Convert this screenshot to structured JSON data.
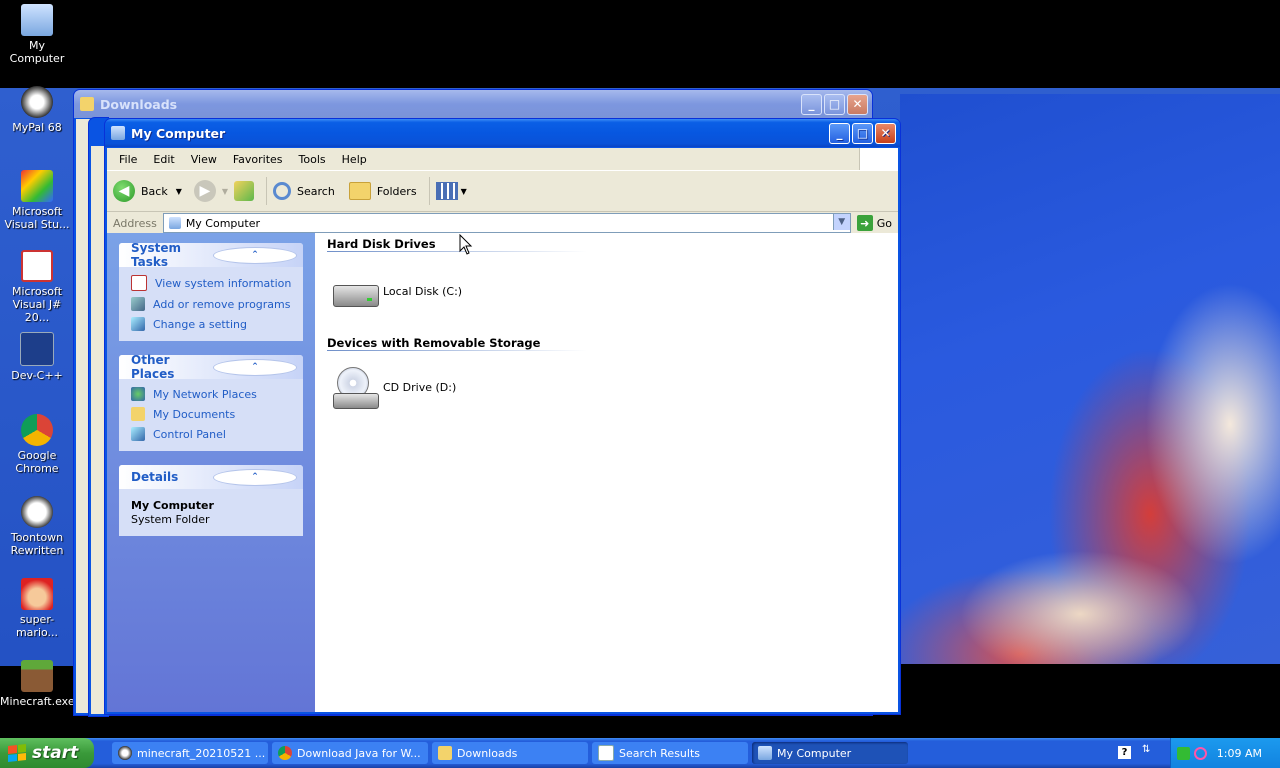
{
  "desktop": {
    "icons": [
      {
        "label": "My Computer"
      },
      {
        "label": "MyPal 68"
      },
      {
        "label": "Microsoft Visual Stu..."
      },
      {
        "label": "Microsoft Visual J# 20..."
      },
      {
        "label": "Dev-C++"
      },
      {
        "label": "Google Chrome"
      },
      {
        "label": "Toontown Rewritten"
      },
      {
        "label": "super-mario..."
      },
      {
        "label": "Minecraft.exe"
      }
    ]
  },
  "bg_window": {
    "title": "Downloads"
  },
  "window": {
    "title": "My Computer",
    "menu": [
      "File",
      "Edit",
      "View",
      "Favorites",
      "Tools",
      "Help"
    ],
    "toolbar": {
      "back": "Back",
      "search": "Search",
      "folders": "Folders"
    },
    "address": {
      "label": "Address",
      "value": "My Computer",
      "go": "Go"
    },
    "tasks": {
      "system": {
        "title": "System Tasks",
        "links": [
          "View system information",
          "Add or remove programs",
          "Change a setting"
        ]
      },
      "other": {
        "title": "Other Places",
        "links": [
          "My Network Places",
          "My Documents",
          "Control Panel"
        ]
      },
      "details": {
        "title": "Details",
        "name": "My Computer",
        "type": "System Folder"
      }
    },
    "groups": {
      "hdd": {
        "title": "Hard Disk Drives",
        "items": [
          "Local Disk (C:)"
        ]
      },
      "removable": {
        "title": "Devices with Removable Storage",
        "items": [
          "CD Drive (D:)"
        ]
      }
    }
  },
  "taskbar": {
    "start": "start",
    "items": [
      "minecraft_20210521 ...",
      "Download Java for W...",
      "Downloads",
      "Search Results",
      "My Computer"
    ],
    "clock": "1:09 AM"
  },
  "colors": {
    "xp_blue": "#0a54e3",
    "task_link": "#215dc6",
    "start_green": "#3a9a3a"
  }
}
